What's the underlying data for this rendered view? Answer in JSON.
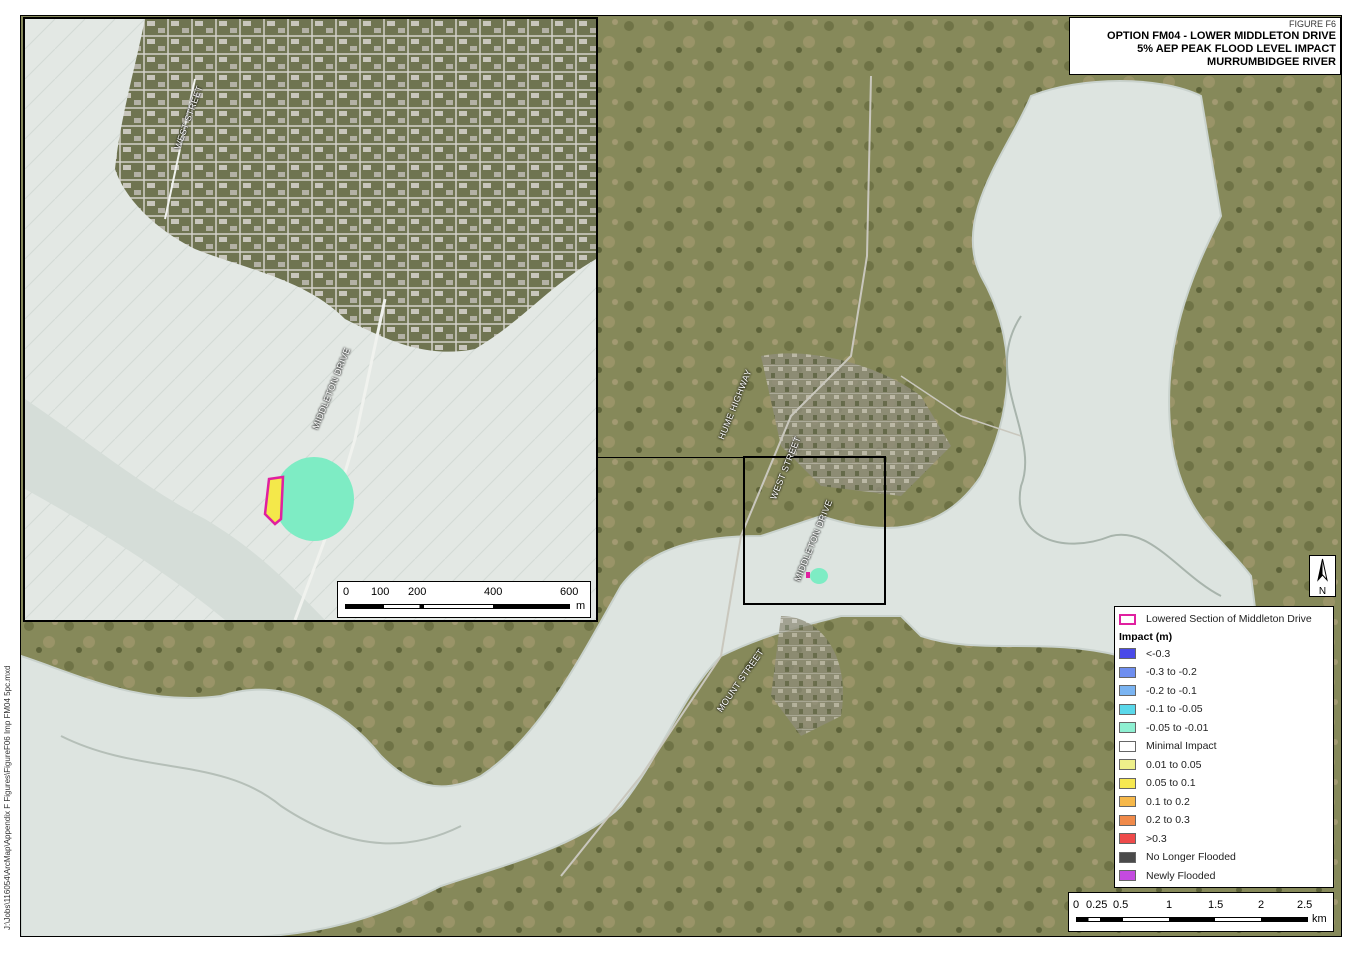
{
  "title_block": {
    "figure_no": "FIGURE F6",
    "line1": "OPTION FM04 - LOWER MIDDLETON DRIVE",
    "line2": "5% AEP PEAK FLOOD LEVEL IMPACT",
    "line3": "MURRUMBIDGEE RIVER"
  },
  "road_labels": {
    "hume_highway": "HUME HIGHWAY",
    "west_street": "WEST STREET",
    "middleton_drive": "MIDDLETON DRIVE",
    "mount_street": "MOUNT STREET",
    "inset_west_street": "WEST STREET",
    "inset_middleton_drive": "MIDDLETON DRIVE"
  },
  "legend": {
    "lowered_section": "Lowered Section of Middleton Drive",
    "lowered_color": "#e020a0",
    "impact_heading": "Impact (m)",
    "classes": [
      {
        "label": "<-0.3",
        "color": "#4a4ae8"
      },
      {
        "label": "-0.3 to -0.2",
        "color": "#6e8ef0"
      },
      {
        "label": "-0.2 to -0.1",
        "color": "#7ab4f2"
      },
      {
        "label": "-0.1 to -0.05",
        "color": "#5ad8ea"
      },
      {
        "label": "-0.05 to -0.01",
        "color": "#8ef0d2"
      },
      {
        "label": "Minimal Impact",
        "color": "#ffffff"
      },
      {
        "label": "0.01 to 0.05",
        "color": "#eef08a"
      },
      {
        "label": "0.05 to 0.1",
        "color": "#f6e850"
      },
      {
        "label": "0.1 to 0.2",
        "color": "#f6b84a"
      },
      {
        "label": "0.2 to 0.3",
        "color": "#f08a4a"
      },
      {
        "label": ">0.3",
        "color": "#ee4a4a"
      },
      {
        "label": "No Longer Flooded",
        "color": "#4a4a4a"
      },
      {
        "label": "Newly Flooded",
        "color": "#c44ae0"
      }
    ]
  },
  "inset_scale": {
    "ticks": [
      "0",
      "100",
      "200",
      "400",
      "600"
    ],
    "unit": "m"
  },
  "main_scale": {
    "ticks": [
      "0",
      "0.25",
      "0.5",
      "1",
      "1.5",
      "2",
      "2.5"
    ],
    "unit": "km"
  },
  "north_arrow": {
    "letter": "N",
    "icon": "north-arrow-icon"
  },
  "file_path": "J:\\Jobs\\116054\\ArcMap\\Appendix F Figures\\FigureF06 Imp FM04 5pc.mxd",
  "colors": {
    "terrain": "#8a8a5a",
    "floodplain": "#dfe6e2",
    "impact_area": "#7eecc4",
    "impact_yellow": "#f4e84a"
  }
}
